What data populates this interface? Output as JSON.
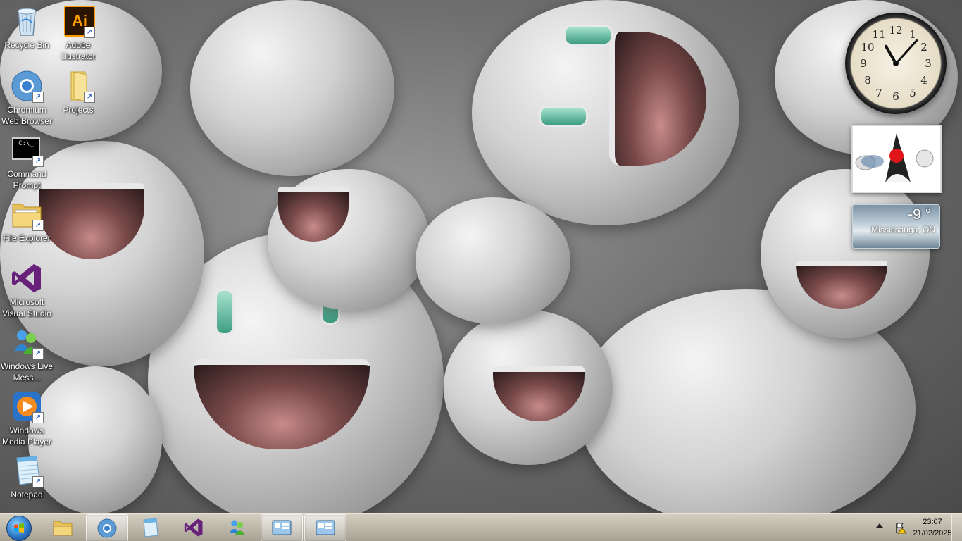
{
  "desktop": {
    "icons": [
      {
        "label": "Recycle Bin",
        "icon": "recycle-bin-icon"
      },
      {
        "label": "Adobe Illustrator",
        "icon": "illustrator-icon",
        "badge": "Ai"
      },
      {
        "label": "Chromium Web Browser",
        "icon": "chromium-icon"
      },
      {
        "label": "Projects",
        "icon": "folder-icon"
      },
      {
        "label": "Command Prompt",
        "icon": "cmd-icon",
        "badge": "C:\\_"
      },
      {
        "label": "File Explorer",
        "icon": "file-explorer-icon"
      },
      {
        "label": "Microsoft Visual Studio",
        "icon": "visual-studio-icon"
      },
      {
        "label": "Windows Live Mess...",
        "icon": "messenger-icon"
      },
      {
        "label": "Windows Media Player",
        "icon": "media-player-icon"
      },
      {
        "label": "Notepad",
        "icon": "notepad-icon"
      }
    ]
  },
  "gadgets": {
    "clock": {
      "numbers": [
        "12",
        "1",
        "2",
        "3",
        "4",
        "5",
        "6",
        "7",
        "8",
        "9",
        "10",
        "11"
      ],
      "time": "23:07"
    },
    "weather": {
      "temperature": "-9 °",
      "location": "Mississauga, ON"
    }
  },
  "taskbar": {
    "buttons": [
      {
        "name": "file-explorer",
        "icon": "folder-icon",
        "active": false
      },
      {
        "name": "chromium",
        "icon": "chromium-icon",
        "active": true
      },
      {
        "name": "notepad",
        "icon": "notepad-icon",
        "active": false
      },
      {
        "name": "visual-studio",
        "icon": "visual-studio-icon",
        "active": false
      },
      {
        "name": "messenger",
        "icon": "messenger-icon",
        "active": false
      },
      {
        "name": "remote-window-1",
        "icon": "gadget-window-icon",
        "active": true
      },
      {
        "name": "remote-window-2",
        "icon": "gadget-window-icon",
        "active": true
      }
    ],
    "clock": {
      "time": "23:07",
      "date": "21/02/2025"
    }
  },
  "colors": {
    "accent": "#2c7ac9",
    "vs_purple": "#68217a",
    "illustrator_orange": "#ff9a00"
  }
}
